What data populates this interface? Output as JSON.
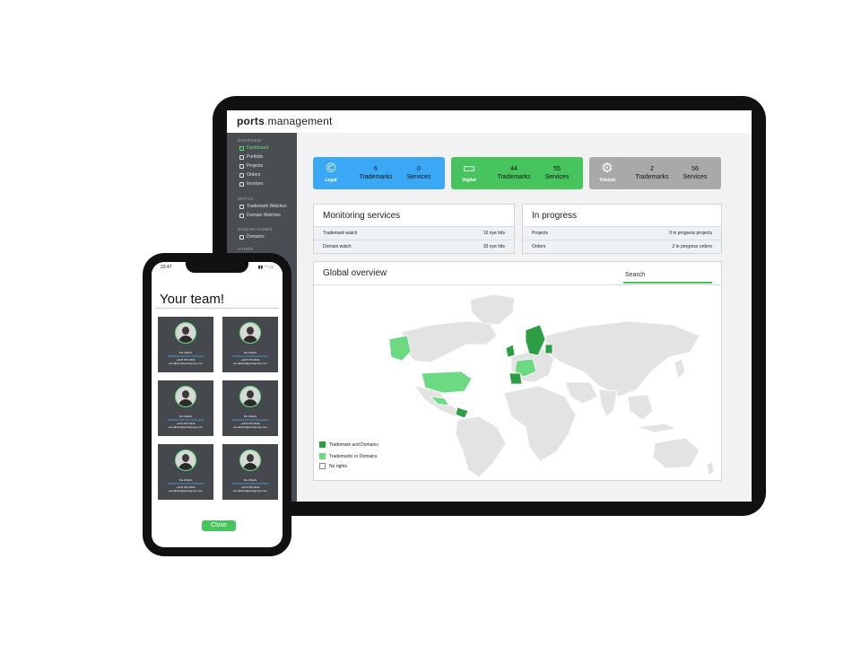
{
  "app": {
    "brand_prefix": "ports",
    "brand_dot": ".",
    "brand_suffix": "management"
  },
  "sidebar": {
    "sections": [
      {
        "label": "OVERVIEW",
        "items": [
          "Dashboard",
          "Portfolio",
          "Projects",
          "Orders",
          "Invoices"
        ]
      },
      {
        "label": "WATCH",
        "items": [
          "Trademark Watches",
          "Domain Watches"
        ]
      },
      {
        "label": "DOMAIN NAMES",
        "items": [
          "Domains"
        ]
      },
      {
        "label": "OTHER",
        "items": []
      }
    ],
    "active_item": "Dashboard"
  },
  "summary_cards": [
    {
      "category": "Legal",
      "icon": "copyright-icon",
      "color": "#3aa8f5",
      "stats": [
        {
          "value": "6",
          "label": "Trademarks"
        },
        {
          "value": "0",
          "label": "Services"
        }
      ]
    },
    {
      "category": "Digital",
      "icon": "laptop-icon",
      "color": "#48c45e",
      "stats": [
        {
          "value": "44",
          "label": "Trademarks"
        },
        {
          "value": "55",
          "label": "Services"
        }
      ]
    },
    {
      "category": "Teknisk",
      "icon": "gears-icon",
      "color": "#a9a9a9",
      "stats": [
        {
          "value": "2",
          "label": "Trademarks"
        },
        {
          "value": "56",
          "label": "Services"
        }
      ]
    }
  ],
  "monitoring": {
    "title": "Monitoring services",
    "rows": [
      {
        "label": "Trademark watch",
        "value": "16 nye hits"
      },
      {
        "label": "Domain watch",
        "value": "33 nye hits"
      }
    ]
  },
  "in_progress": {
    "title": "In progress",
    "rows": [
      {
        "label": "Projects",
        "value": "0 in progress projects"
      },
      {
        "label": "Orders",
        "value": "2 in progress orders"
      }
    ]
  },
  "overview": {
    "title": "Global overview",
    "search_placeholder": "Search",
    "legend": [
      {
        "label": "Trademark and Domains",
        "color": "#2e9e44"
      },
      {
        "label": "Trademarks or Domains",
        "color": "#6cd983"
      },
      {
        "label": "No rights",
        "color": "#ffffff"
      }
    ],
    "colors": {
      "land": "#e3e3e3",
      "both": "#2e9e44",
      "either": "#6cd983"
    }
  },
  "phone": {
    "time": "23:47",
    "status": "▮▮ ◠ ▭",
    "title": "Your team!",
    "close_label": "Close",
    "members": [
      {
        "name": "Per Alhelm",
        "role": "ADMINISTRATIVE MANAGER",
        "phone": "+46 8 570 0043",
        "email": "per.alhelm@portsgroup.com"
      },
      {
        "name": "Per Alhelm",
        "role": "ADMINISTRATIVE MANAGER",
        "phone": "+46 8 570 0043",
        "email": "per.alhelm@portsgroup.com"
      },
      {
        "name": "Per Alhelm",
        "role": "ADMINISTRATIVE MANAGER",
        "phone": "+46 8 570 0043",
        "email": "per.alhelm@portsgroup.com"
      },
      {
        "name": "Per Alhelm",
        "role": "ADMINISTRATIVE MANAGER",
        "phone": "+46 8 570 0043",
        "email": "per.alhelm@portsgroup.com"
      },
      {
        "name": "Per Alhelm",
        "role": "ADMINISTRATIVE MANAGER",
        "phone": "+46 8 570 0043",
        "email": "per.alhelm@portsgroup.com"
      },
      {
        "name": "Per Alhelm",
        "role": "ADMINISTRATIVE MANAGER",
        "phone": "+46 8 570 0043",
        "email": "per.alhelm@portsgroup.com"
      }
    ]
  }
}
